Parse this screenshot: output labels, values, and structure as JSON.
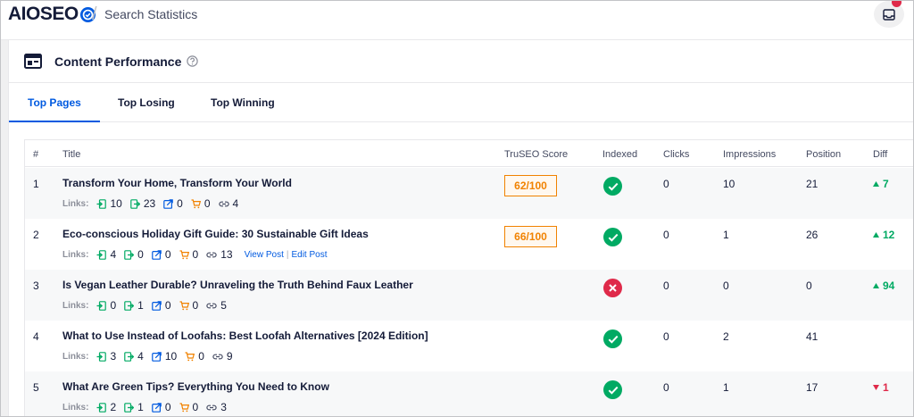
{
  "header": {
    "logo_prefix": "AIO",
    "logo_suffix": "SEO",
    "separator": "/",
    "page_title": "Search Statistics"
  },
  "card": {
    "title": "Content Performance"
  },
  "tabs": [
    {
      "label": "Top Pages",
      "active": true
    },
    {
      "label": "Top Losing",
      "active": false
    },
    {
      "label": "Top Winning",
      "active": false
    }
  ],
  "table": {
    "columns": {
      "num": "#",
      "title": "Title",
      "score": "TruSEO Score",
      "indexed": "Indexed",
      "clicks": "Clicks",
      "impressions": "Impressions",
      "position": "Position",
      "diff": "Diff"
    },
    "links_label": "Links:",
    "rows": [
      {
        "num": "1",
        "title": "Transform Your Home, Transform Your World",
        "inbound": "10",
        "outbound": "23",
        "external": "0",
        "affiliate": "0",
        "total": "4",
        "score": "62/100",
        "indexed": "ok",
        "clicks": "0",
        "impressions": "10",
        "position": "21",
        "diff": "7",
        "diff_dir": "up"
      },
      {
        "num": "2",
        "title": "Eco-conscious Holiday Gift Guide: 30 Sustainable Gift Ideas",
        "inbound": "4",
        "outbound": "0",
        "external": "0",
        "affiliate": "0",
        "total": "13",
        "view_post": "View Post",
        "action_sep": "|",
        "edit_post": "Edit Post",
        "score": "66/100",
        "indexed": "ok",
        "clicks": "0",
        "impressions": "1",
        "position": "26",
        "diff": "12",
        "diff_dir": "up"
      },
      {
        "num": "3",
        "title": "Is Vegan Leather Durable? Unraveling the Truth Behind Faux Leather",
        "inbound": "0",
        "outbound": "1",
        "external": "0",
        "affiliate": "0",
        "total": "5",
        "indexed": "bad",
        "clicks": "0",
        "impressions": "0",
        "position": "0",
        "diff": "94",
        "diff_dir": "up"
      },
      {
        "num": "4",
        "title": "What to Use Instead of Loofahs: Best Loofah Alternatives [2024 Edition]",
        "inbound": "3",
        "outbound": "4",
        "external": "10",
        "affiliate": "0",
        "total": "9",
        "indexed": "ok",
        "clicks": "0",
        "impressions": "2",
        "position": "41"
      },
      {
        "num": "5",
        "title": "What Are Green Tips? Everything You Need to Know",
        "inbound": "2",
        "outbound": "1",
        "external": "0",
        "affiliate": "0",
        "total": "3",
        "indexed": "ok",
        "clicks": "0",
        "impressions": "1",
        "position": "17",
        "diff": "1",
        "diff_dir": "down"
      }
    ]
  },
  "colors": {
    "accent": "#005ae0",
    "score": "#f18200",
    "success": "#00aa63",
    "danger": "#df2a4a"
  }
}
